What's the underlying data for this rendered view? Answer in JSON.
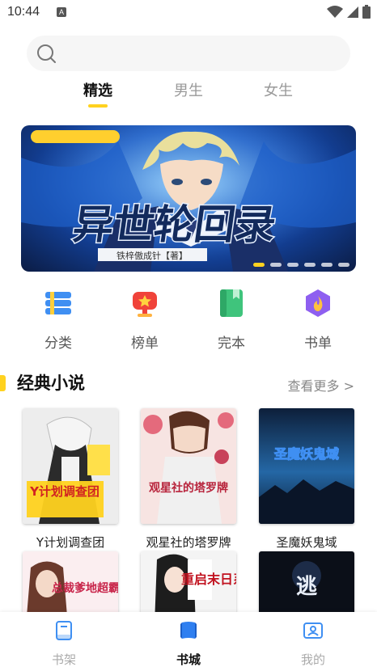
{
  "status_bar": {
    "time": "10:44",
    "notification_glyph": "A"
  },
  "search": {
    "placeholder": ""
  },
  "tabs": [
    {
      "label": "精选",
      "active": true
    },
    {
      "label": "男生",
      "active": false
    },
    {
      "label": "女生",
      "active": false
    }
  ],
  "banner": {
    "title": "异世轮回录",
    "subtitle": "铁梓傲成针【著】",
    "dots_count": 6,
    "active_dot": 0
  },
  "quick_nav": [
    {
      "label": "分类",
      "icon": "category-list-icon"
    },
    {
      "label": "榜单",
      "icon": "trophy-icon"
    },
    {
      "label": "完本",
      "icon": "green-book-icon"
    },
    {
      "label": "书单",
      "icon": "hexagon-flame-icon"
    }
  ],
  "section": {
    "title": "经典小说",
    "more": "查看更多 >"
  },
  "books": [
    {
      "title": "Y计划调查团",
      "cover_text": "Y计划调查团"
    },
    {
      "title": "观星社的塔罗牌",
      "cover_text": "观星社的塔罗牌"
    },
    {
      "title": "圣魔妖鬼域",
      "cover_text": "圣魔妖鬼域"
    },
    {
      "title": "",
      "cover_text": "总裁爹地超霸"
    },
    {
      "title": "",
      "cover_text": "重启末日系"
    },
    {
      "title": "",
      "cover_text": "逃"
    }
  ],
  "bottom_nav": [
    {
      "label": "书架",
      "icon": "bookshelf-icon",
      "active": false
    },
    {
      "label": "书城",
      "icon": "bookstore-icon",
      "active": true
    },
    {
      "label": "我的",
      "icon": "profile-icon",
      "active": false
    }
  ],
  "colors": {
    "accent": "#ffd21f",
    "inactive": "#999999",
    "active_text": "#111111"
  }
}
